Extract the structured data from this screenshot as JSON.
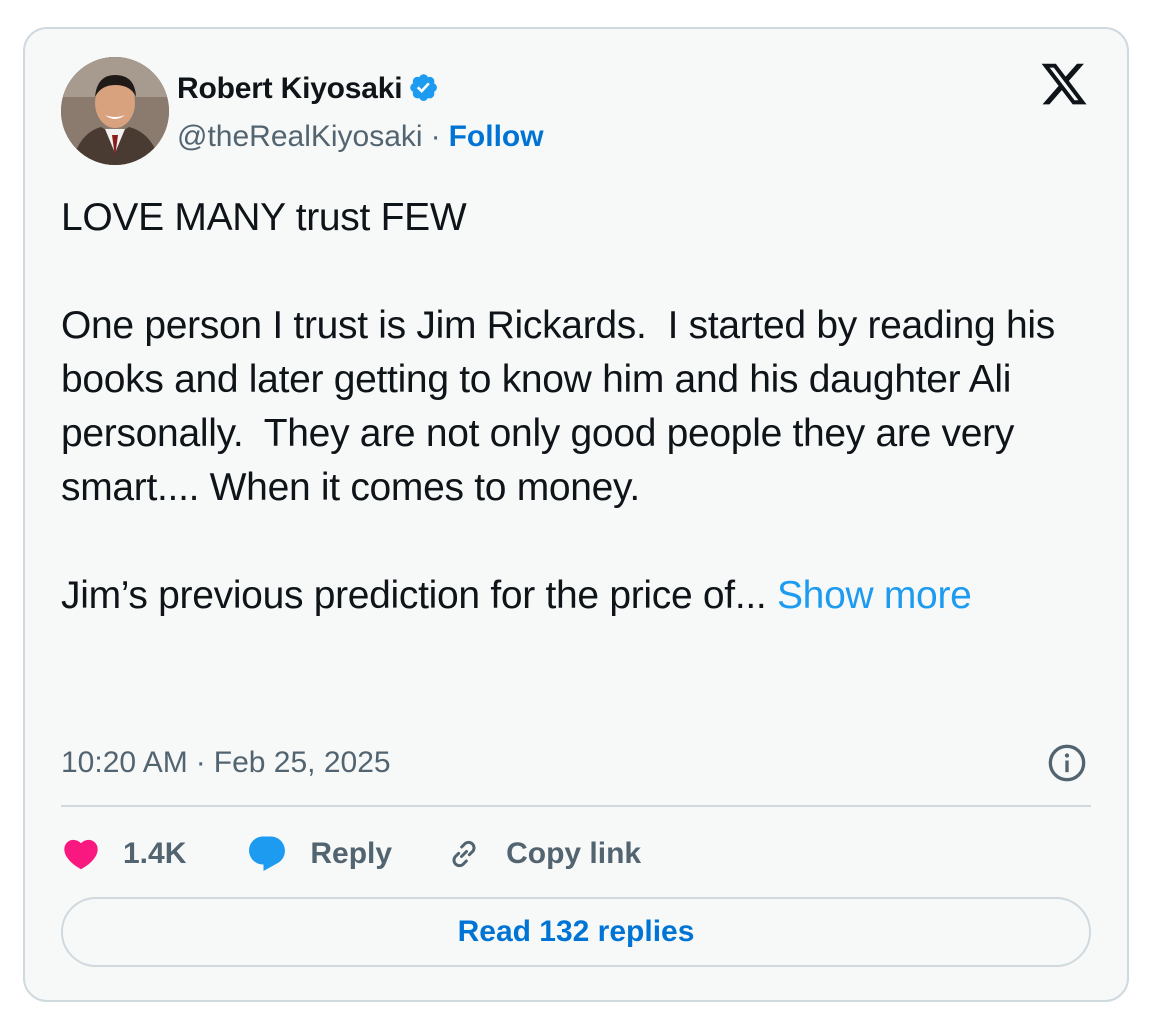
{
  "author": {
    "display_name": "Robert Kiyosaki",
    "handle": "@theRealKiyosaki",
    "separator": "·",
    "follow_label": "Follow"
  },
  "tweet": {
    "line1": "LOVE MANY trust FEW",
    "paragraph2": "One person I trust is Jim Rickards.  I started by reading his books and later getting to know him and his daughter Ali personally.  They are not only good people they are very smart.... When it comes to money.",
    "paragraph3": "Jim’s previous prediction for the price of... ",
    "show_more_label": "Show more"
  },
  "timestamp": {
    "time": "10:20 AM",
    "separator": "·",
    "date": "Feb 25, 2025"
  },
  "actions": {
    "likes_count": "1.4K",
    "reply_label": "Reply",
    "copy_link_label": "Copy link"
  },
  "read_replies_label": "Read 132 replies",
  "colors": {
    "accent_blue": "#1d9bf0",
    "link_blue": "#0074d4",
    "like_pink": "#f91880",
    "text_primary": "#0f1419",
    "text_secondary": "#536471",
    "border": "#cfd9de",
    "card_bg": "#f7f9f9"
  },
  "icons": {
    "verified": "verified-badge-icon",
    "brand": "x-logo-icon",
    "info": "info-icon",
    "like": "heart-icon",
    "reply": "speech-bubble-icon",
    "copy_link": "link-icon"
  }
}
